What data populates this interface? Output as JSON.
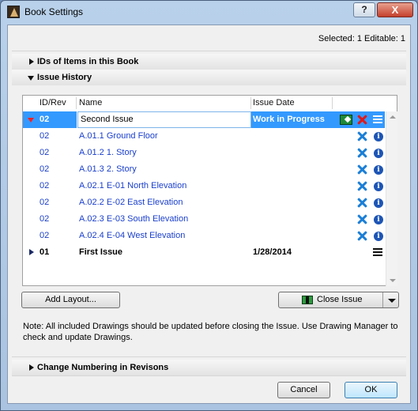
{
  "window": {
    "title": "Book Settings",
    "help_label": "?",
    "close_label": "X"
  },
  "header": {
    "selected_info": "Selected: 1 Editable: 1"
  },
  "sections": {
    "ids": "IDs of Items in this Book",
    "issue_history": "Issue History",
    "change_numbering": "Change Numbering in Revisons"
  },
  "table": {
    "columns": [
      "ID/Rev",
      "Name",
      "Issue Date"
    ],
    "rows": [
      {
        "id": "02",
        "name": "Second Issue",
        "date": "Work in Progress"
      },
      {
        "id": "02",
        "name": "A.01.1 Ground Floor"
      },
      {
        "id": "02",
        "name": "A.01.2 1. Story"
      },
      {
        "id": "02",
        "name": "A.01.3 2. Story"
      },
      {
        "id": "02",
        "name": "A.02.1 E-01 North Elevation"
      },
      {
        "id": "02",
        "name": "A.02.2 E-02 East Elevation"
      },
      {
        "id": "02",
        "name": "A.02.3 E-03 South Elevation"
      },
      {
        "id": "02",
        "name": "A.02.4 E-04 West Elevation"
      },
      {
        "id": "01",
        "name": "First Issue",
        "date": "1/28/2014"
      }
    ]
  },
  "buttons": {
    "add_layout": "Add Layout...",
    "close_issue": "Close Issue",
    "cancel": "Cancel",
    "ok": "OK"
  },
  "note": "Note: All included Drawings should be updated before closing the Issue. Use Drawing Manager to check and update Drawings.",
  "icons": [
    "help-icon",
    "close-icon",
    "expand-triangle-icon",
    "collapse-triangle-icon",
    "marker-icon",
    "delete-icon",
    "info-icon",
    "list-icon",
    "issue-icon",
    "dropdown-arrow-icon"
  ],
  "colors": {
    "selection": "#3399ff",
    "link_text": "#1a3fcc",
    "delete_red": "#e01818",
    "delete_blue": "#1b7fd6"
  }
}
